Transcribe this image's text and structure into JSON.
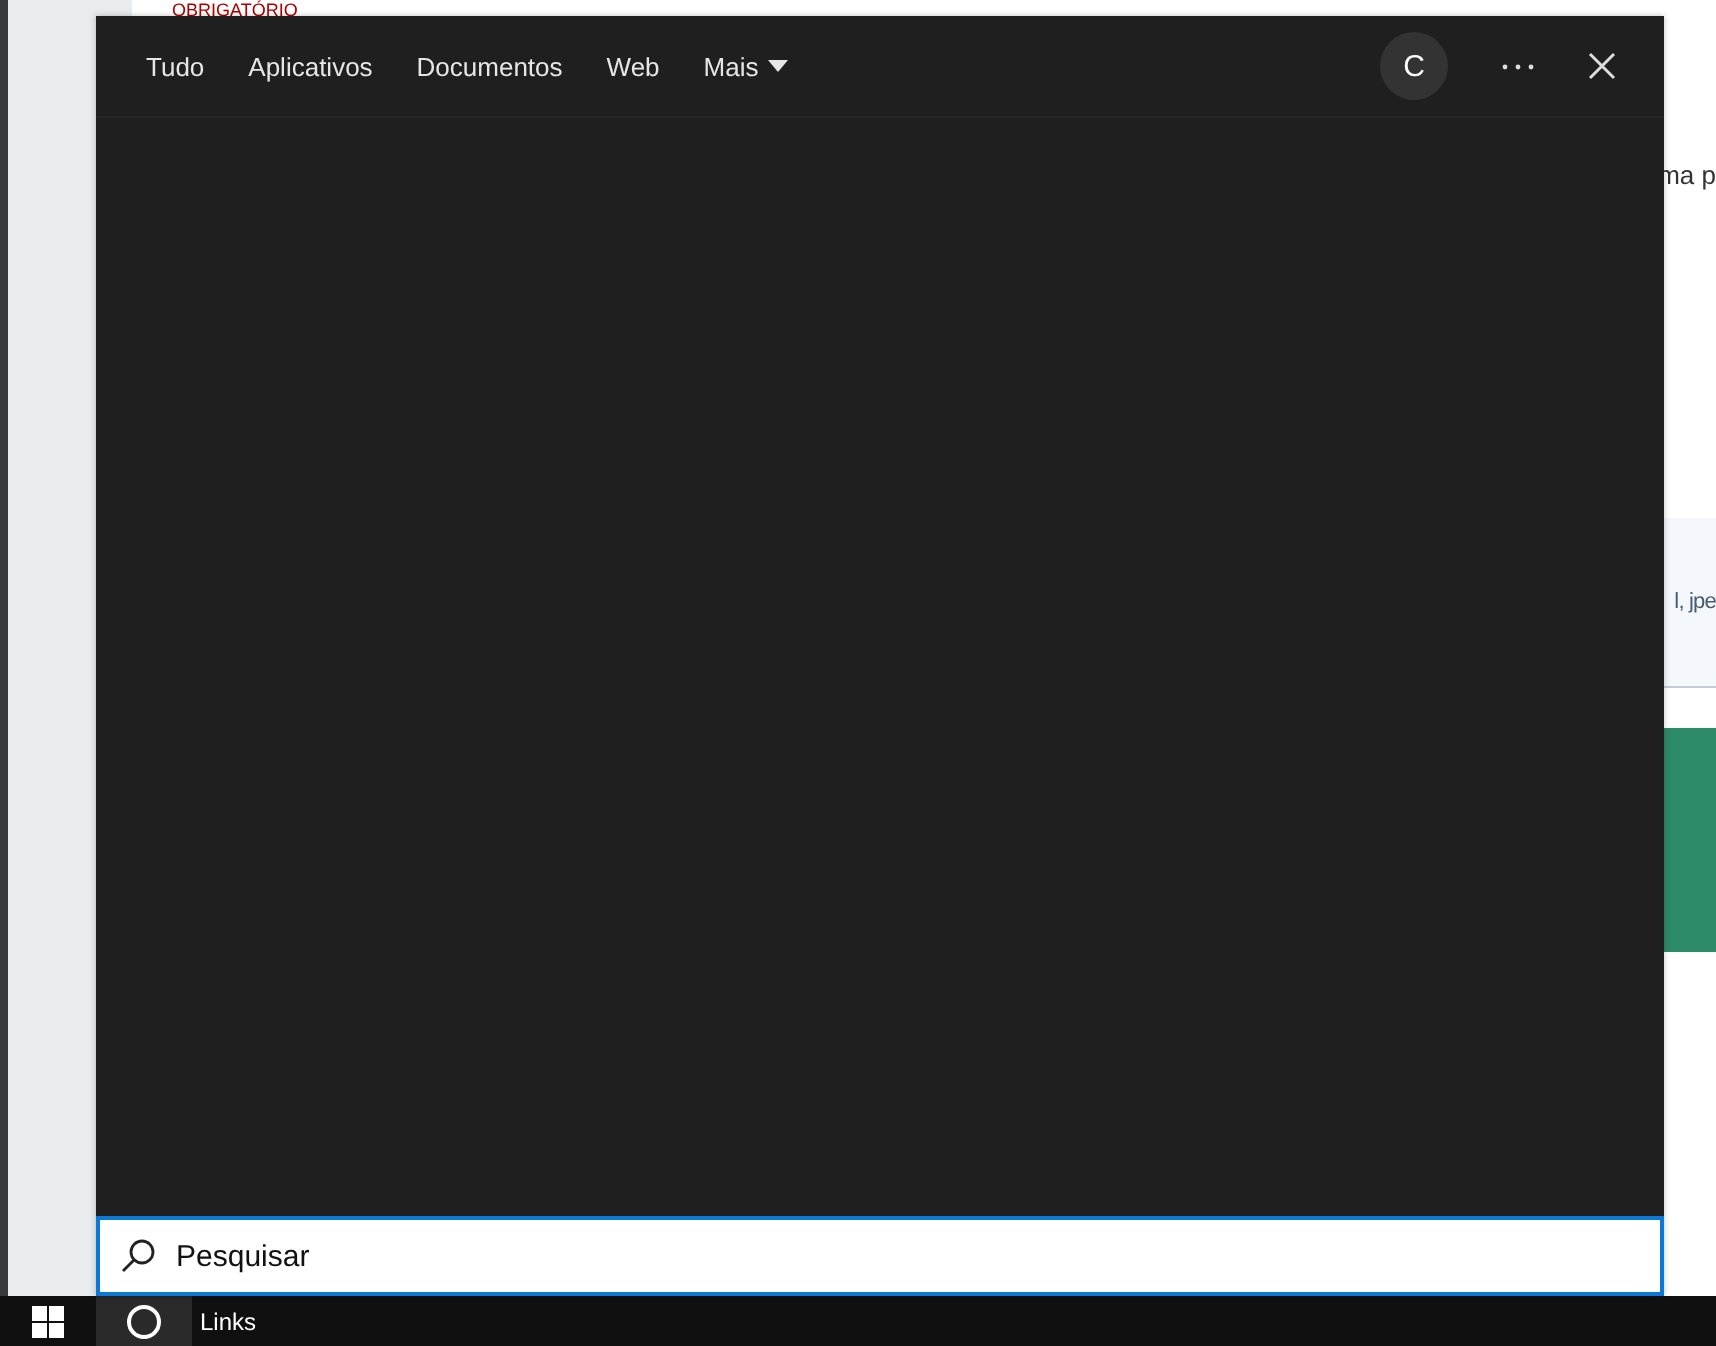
{
  "background_page": {
    "heading": "OBRIGATÓRIO",
    "fragment_1": "ma p",
    "fragment_2": "l, jpe"
  },
  "search_panel": {
    "tabs": [
      {
        "label": "Tudo",
        "kind": "plain"
      },
      {
        "label": "Aplicativos",
        "kind": "plain"
      },
      {
        "label": "Documentos",
        "kind": "plain"
      },
      {
        "label": "Web",
        "kind": "plain"
      },
      {
        "label": "Mais",
        "kind": "dropdown"
      }
    ],
    "avatar": {
      "initial": "C"
    },
    "search": {
      "placeholder": "Pesquisar"
    }
  },
  "taskbar": {
    "label": "Links"
  }
}
